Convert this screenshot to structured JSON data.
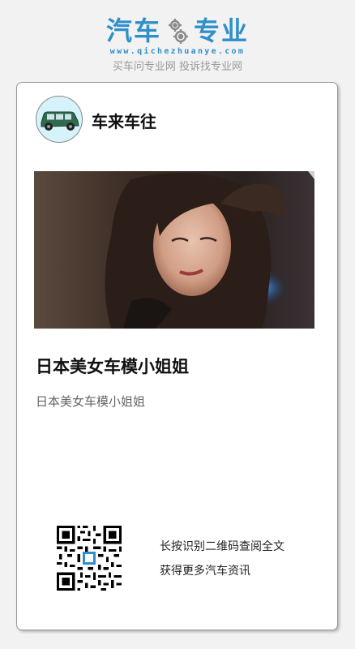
{
  "brand": {
    "left_word": "汽车",
    "right_word": "专业",
    "url": "www.qichezhuanye.com",
    "slogan": "买车问专业网 投诉找专业网",
    "accent_color": "#2f8fc9"
  },
  "post": {
    "author": "车来车往",
    "avatar_icon": "car-icon",
    "title": "日本美女车模小姐姐",
    "summary": "日本美女车模小姐姐"
  },
  "qr_section": {
    "qr_icon": "qr-code-icon",
    "line1": "长按识别二维码查阅全文",
    "line2": "获得更多汽车资讯"
  }
}
